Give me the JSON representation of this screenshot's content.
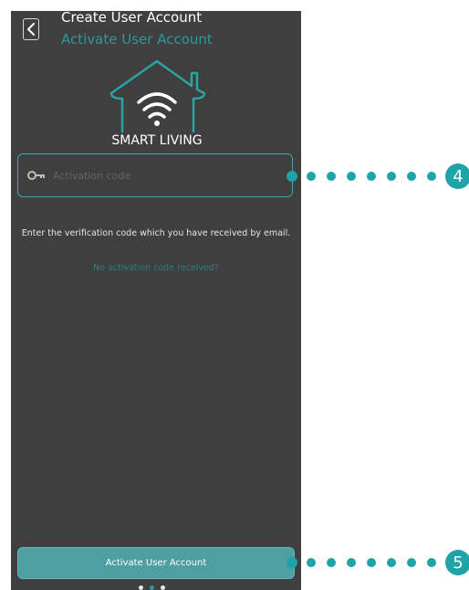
{
  "header": {
    "title": "Create User Account",
    "subtitle": "Activate User Account"
  },
  "logo": {
    "text": "SMART LIVING"
  },
  "activation_field": {
    "placeholder": "Activation code",
    "value": ""
  },
  "info_text": "Enter the verification code which you have received by email.",
  "resend_link": "No activation code received?",
  "primary_button": "Activate User Account",
  "pagination": {
    "total": 3,
    "active_index": 1
  },
  "callouts": [
    {
      "label": "4"
    },
    {
      "label": "5"
    }
  ],
  "colors": {
    "background": "#3f3f3f",
    "accent": "#2a9a9d",
    "callout": "#1ea3a8",
    "button": "#4f9ea1"
  }
}
